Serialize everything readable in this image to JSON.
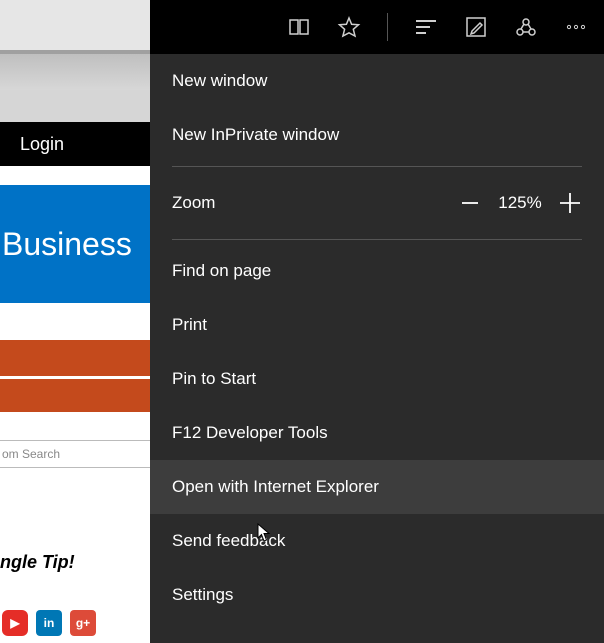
{
  "background": {
    "login_label": "Login",
    "blue_text": "Business",
    "search_placeholder": "om Search",
    "tip_text": "ngle Tip!"
  },
  "social": {
    "youtube": "▶",
    "linkedin": "in",
    "google_plus": "g+"
  },
  "zoom": {
    "label": "Zoom",
    "value": "125%"
  },
  "menu": {
    "new_window": "New window",
    "new_inprivate": "New InPrivate window",
    "find": "Find on page",
    "print": "Print",
    "pin": "Pin to Start",
    "devtools": "F12 Developer Tools",
    "open_ie": "Open with Internet Explorer",
    "feedback": "Send feedback",
    "settings": "Settings"
  }
}
